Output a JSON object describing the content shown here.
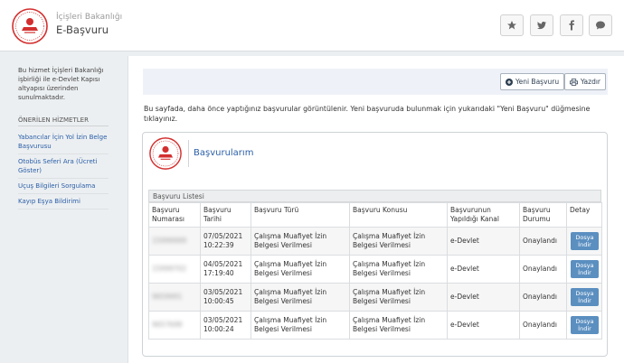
{
  "header": {
    "brand_small": "İçişleri Bakanlığı",
    "brand_big": "E-Başvuru",
    "buttons": [
      "star-icon",
      "twitter-icon",
      "facebook-icon",
      "comment-icon"
    ]
  },
  "sidebar": {
    "intro": "Bu hizmet İçişleri Bakanlığı işbirliği ile e-Devlet Kapısı altyapısı üzerinden sunulmaktadır.",
    "section_title": "ÖNERİLEN HİZMETLER",
    "items": [
      {
        "label": "Yabancılar İçin Yol İzin Belge Başvurusu"
      },
      {
        "label": "Otobüs Seferi Ara (Ücreti Göster)"
      },
      {
        "label": "Uçuş Bilgileri Sorgulama"
      },
      {
        "label": "Kayıp Eşya Bildirimi"
      }
    ]
  },
  "toolbar": {
    "new_label": "Yeni Başvuru",
    "print_label": "Yazdır"
  },
  "description": "Bu sayfada, daha önce yaptığınız başvurular görüntülenir. Yeni başvuruda bulunmak için yukarıdaki \"Yeni Başvuru\" düğmesine tıklayınız.",
  "card": {
    "title": "Başvurularım",
    "list_title": "Başvuru Listesi",
    "columns": [
      "Başvuru Numarası",
      "Başvuru Tarihi",
      "Başvuru Türü",
      "Başvuru Konusu",
      "Başvurunun Yapıldığı Kanal",
      "Başvuru Durumu",
      "Detay"
    ],
    "rows": [
      {
        "no": "15999999",
        "date": "07/05/2021 10:22:39",
        "type": "Çalışma Muafiyet İzin Belgesi Verilmesi",
        "subject": "Çalışma Muafiyet İzin Belgesi Verilmesi",
        "channel": "e-Devlet",
        "status": "Onaylandı",
        "action": "Dosya İndir"
      },
      {
        "no": "15999702",
        "date": "04/05/2021 17:19:40",
        "type": "Çalışma Muafiyet İzin Belgesi Verilmesi",
        "subject": "Çalışma Muafiyet İzin Belgesi Verilmesi",
        "channel": "e-Devlet",
        "status": "Onaylandı",
        "action": "Dosya İndir"
      },
      {
        "no": "9659991",
        "date": "03/05/2021 10:00:45",
        "type": "Çalışma Muafiyet İzin Belgesi Verilmesi",
        "subject": "Çalışma Muafiyet İzin Belgesi Verilmesi",
        "channel": "e-Devlet",
        "status": "Onaylandı",
        "action": "Dosya İndir"
      },
      {
        "no": "9657698",
        "date": "03/05/2021 10:00:24",
        "type": "Çalışma Muafiyet İzin Belgesi Verilmesi",
        "subject": "Çalışma Muafiyet İzin Belgesi Verilmesi",
        "channel": "e-Devlet",
        "status": "Onaylandı",
        "action": "Dosya İndir"
      }
    ]
  },
  "colors": {
    "link": "#2a5ea8",
    "button": "#5b8fc0",
    "seal": "#d32f2f"
  }
}
